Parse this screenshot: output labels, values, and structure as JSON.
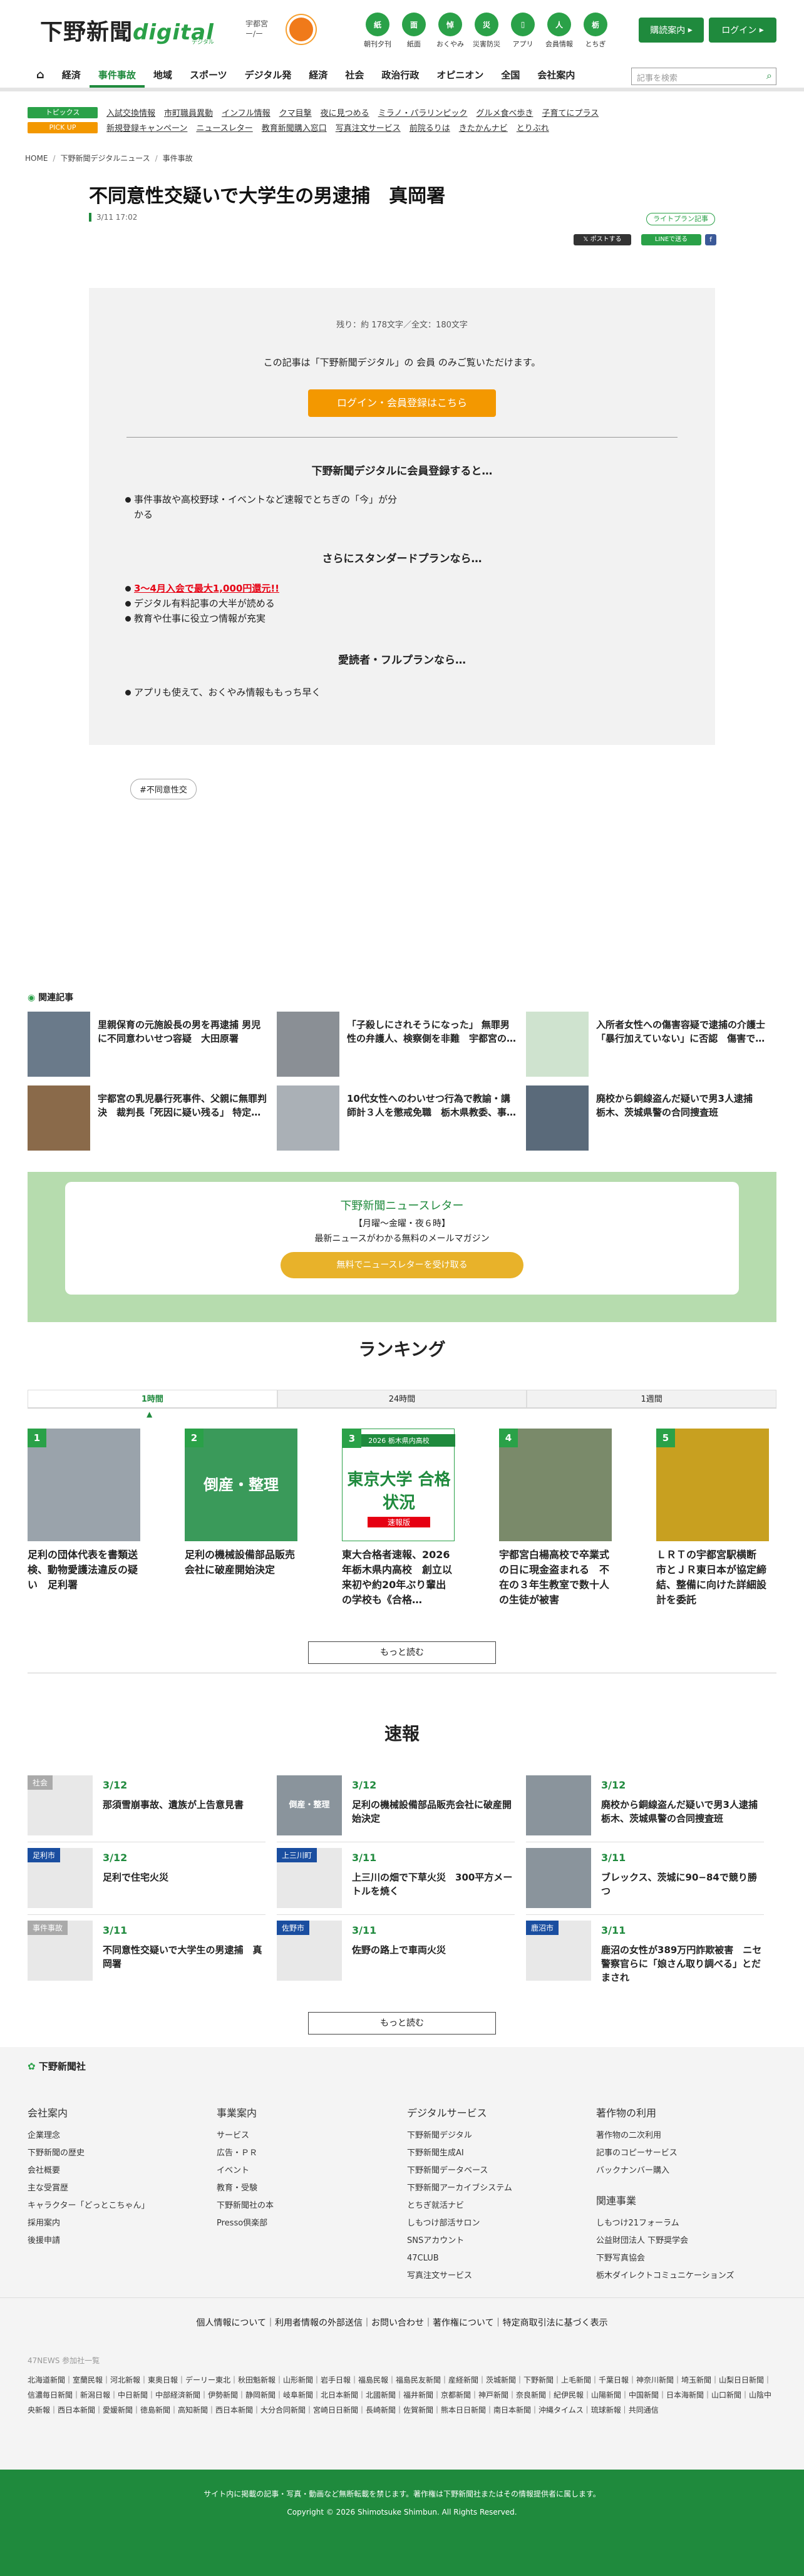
{
  "header": {
    "logo_main": "下野新聞",
    "logo_sub": "digital",
    "logo_sub2": "デジタル",
    "weather_city": "宇都宮",
    "weather_temp": "ー/ー",
    "icons": [
      {
        "label": "朝刊夕刊",
        "icon": "newspaper-icon",
        "mark": "紙"
      },
      {
        "label": "紙面",
        "icon": "page-icon",
        "mark": "面"
      },
      {
        "label": "おくやみ",
        "icon": "flower-icon",
        "mark": "悼"
      },
      {
        "label": "災害防災",
        "icon": "disaster-icon",
        "mark": "災"
      },
      {
        "label": "アプリ",
        "icon": "app-icon",
        "mark": "▯"
      },
      {
        "label": "会員情報",
        "icon": "user-icon",
        "mark": "人"
      },
      {
        "label": "とちぎ",
        "icon": "tochigi-icon",
        "mark": "栃"
      }
    ],
    "subscribe": "購読案内",
    "login": "ログイン"
  },
  "nav": {
    "items": [
      "経済",
      "事件事故",
      "地域",
      "スポーツ",
      "デジタル発",
      "経済",
      "社会",
      "政治行政",
      "オピニオン",
      "全国",
      "会社案内"
    ],
    "search_placeholder": "記事を検索"
  },
  "topics": {
    "label": "トピックス",
    "links": [
      "入試交換情報",
      "市町職員異動",
      "インフル情報",
      "クマ目撃",
      "夜に見つめる",
      "ミラノ・パラリンピック",
      "グルメ食べ歩き",
      "子育てにプラス"
    ]
  },
  "pickup": {
    "label": "PICK UP",
    "links": [
      "新規登録キャンペーン",
      "ニュースレター",
      "教育新聞購入窓口",
      "写真注文サービス",
      "前院るりは",
      "きたかんナビ",
      "とりぶれ"
    ]
  },
  "breadcrumb": [
    "HOME",
    "下野新聞デジタルニュース",
    "事件事故"
  ],
  "article": {
    "title": "不同意性交疑いで大学生の男逮捕　真岡署",
    "date": "3/11 17:02",
    "plan": "ライトプラン記事",
    "share_x": "ポストする",
    "share_line": "LINEで送る",
    "share_fb": "f"
  },
  "paywall": {
    "remain": "残り：約 178文字／全文：180文字",
    "members": "この記事は「下野新聞デジタル」の 会員 のみご覧いただけます。",
    "cta": "ログイン・会員登録はこちら",
    "h1": "下野新聞デジタルに会員登録すると…",
    "b1": "事件事故や高校野球・イベントなど速報でとちぎの「今」が分かる",
    "h2": "さらにスタンダードプランなら…",
    "b2a": "3〜4月入会で最大1,000円還元!!",
    "b2b": "デジタル有料記事の大半が読める",
    "b2c": "教育や仕事に役立つ情報が充実",
    "h3": "愛読者・フルプランなら…",
    "b3": "アプリも使えて、おくやみ情報ももっち早く"
  },
  "keyword": "#不同意性交",
  "related": {
    "title": "関連記事",
    "items": [
      "里親保育の元施設長の男を再逮捕 男児に不同意わいせつ容疑　大田原署",
      "「子殺しにされそうになった」 無罪男性の弁護人、検察側を非難　宇都宮の…",
      "入所者女性への傷害容疑で逮捕の介護士「暴行加えていない」に否認　傷害で…",
      "宇都宮の乳児暴行死事件、父親に無罪判決　裁判長「死因に疑い残る」 特定…",
      "10代女性へのわいせつ行為で教諭・講師計３人を懲戒免職　栃木県教委、事…",
      "廃校から銅線盗んだ疑いで男3人逮捕　栃木、茨城県警の合同捜査班"
    ]
  },
  "newsletter": {
    "title": "下野新聞ニュースレター",
    "sub": "【月曜〜金曜・夜６時】",
    "desc": "最新ニュースがわかる無料のメールマガジン",
    "btn": "無料でニュースレターを受け取る"
  },
  "ranking": {
    "title": "ランキング",
    "tabs": [
      "1時間",
      "24時間",
      "1週間"
    ],
    "items": [
      {
        "n": "1",
        "text": "足利の団体代表を書類送検、動物愛護法違反の疑い　足利署"
      },
      {
        "n": "2",
        "text": "足利の機械設備部品販売会社に破産開始決定",
        "img": "倒産・整理"
      },
      {
        "n": "3",
        "text": "東大合格者速報、2026年栃木県内高校　創立以来初や約20年ぶり輩出の学校も《合格…",
        "img": "東京大学 合格状況",
        "img_top": "2026 栃木県内高校",
        "img_bot": "速報版"
      },
      {
        "n": "4",
        "text": "宇都宮白楊高校で卒業式の日に現金盗まれる　不在の３年生教室で数十人の生徒が被害"
      },
      {
        "n": "5",
        "text": "ＬＲＴの宇都宮駅横断　市とＪＲ東日本が協定締結、整備に向けた詳細設計を委託"
      }
    ],
    "more": "もっと読む"
  },
  "sokuho": {
    "title": "速報",
    "items": [
      {
        "label": "社会",
        "date": "3/12",
        "text": "那須雪崩事故、遺族が上告意見書"
      },
      {
        "label": "",
        "date": "3/12",
        "text": "足利の機械設備部品販売会社に破産開始決定",
        "img": "倒産・整理"
      },
      {
        "label": "",
        "date": "3/12",
        "text": "廃校から銅線盗んだ疑いで男3人逮捕　栃木、茨城県警の合同捜査班"
      },
      {
        "label": "足利市",
        "date": "3/12",
        "text": "足利で住宅火災"
      },
      {
        "label": "上三川町",
        "date": "3/11",
        "text": "上三川の畑で下草火災　300平方メートルを焼く"
      },
      {
        "label": "",
        "date": "3/11",
        "text": "ブレックス、茨城に90−84で競り勝つ"
      },
      {
        "label": "事件事故",
        "date": "3/11",
        "text": "不同意性交疑いで大学生の男逮捕　真岡署"
      },
      {
        "label": "佐野市",
        "date": "3/11",
        "text": "佐野の路上で車両火災"
      },
      {
        "label": "鹿沼市",
        "date": "3/11",
        "text": "鹿沼の女性が389万円詐欺被害　ニセ警察官らに「娘さん取り調べる」とだまされ"
      }
    ],
    "more": "もっと読む"
  },
  "footer": {
    "brand": "下野新聞社",
    "cols": [
      {
        "h": "会社案内",
        "items": [
          "企業理念",
          "下野新聞の歴史",
          "会社概要",
          "主な受賞歴",
          "キャラクター「どっとこちゃん」",
          "採用案内",
          "後援申請"
        ]
      },
      {
        "h": "事業案内",
        "items": [
          "サービス",
          "広告・ＰＲ",
          "イベント",
          "教育・受験",
          "下野新聞社の本",
          "Presso倶楽部"
        ]
      },
      {
        "h": "デジタルサービス",
        "items": [
          "下野新聞デジタル",
          "下野新聞生成AI",
          "下野新聞データベース",
          "下野新聞アーカイブシステム",
          "とちぎ就活ナビ",
          "しもつけ部活サロン",
          "SNSアカウント",
          "47CLUB",
          "写真注文サービス"
        ]
      },
      {
        "h": "著作物の利用",
        "items": [
          "著作物の二次利用",
          "記事のコピーサービス",
          "バックナンバー購入"
        ]
      },
      {
        "h": "関連事業",
        "items": [
          "しもつけ21フォーラム",
          "公益財団法人 下野奨学会",
          "下野写真協会",
          "栃木ダイレクトコミュニケーションズ"
        ]
      }
    ],
    "policy": "個人情報について｜利用者情報の外部送信｜お問い合わせ｜著作権について｜特定商取引法に基づく表示",
    "net_title": "47NEWS 参加社一覧",
    "net": "北海道新聞｜室蘭民報｜河北新報｜東奥日報｜デーリー東北｜秋田魁新報｜山形新聞｜岩手日報｜福島民報｜福島民友新聞｜産経新聞｜茨城新聞｜下野新聞｜上毛新聞｜千葉日報｜神奈川新聞｜埼玉新聞｜山梨日日新聞｜信濃毎日新聞｜新潟日報｜中日新聞｜中部経済新聞｜伊勢新聞｜静岡新聞｜岐阜新聞｜北日本新聞｜北國新聞｜福井新聞｜京都新聞｜神戸新聞｜奈良新聞｜紀伊民報｜山陽新聞｜中国新聞｜日本海新聞｜山口新聞｜山陰中央新報｜西日本新聞｜愛媛新聞｜徳島新聞｜高知新聞｜西日本新聞｜大分合同新聞｜宮崎日日新聞｜長崎新聞｜佐賀新聞｜熊本日日新聞｜南日本新聞｜沖縄タイムス｜琉球新報｜共同通信",
    "notice": "サイト内に掲載の記事・写真・動画など無断転載を禁じます。著作権は下野新聞社またはその情報提供者に属します。",
    "copyright": "Copyright © 2026 Shimotsuke Shimbun. All Rights Reserved."
  }
}
